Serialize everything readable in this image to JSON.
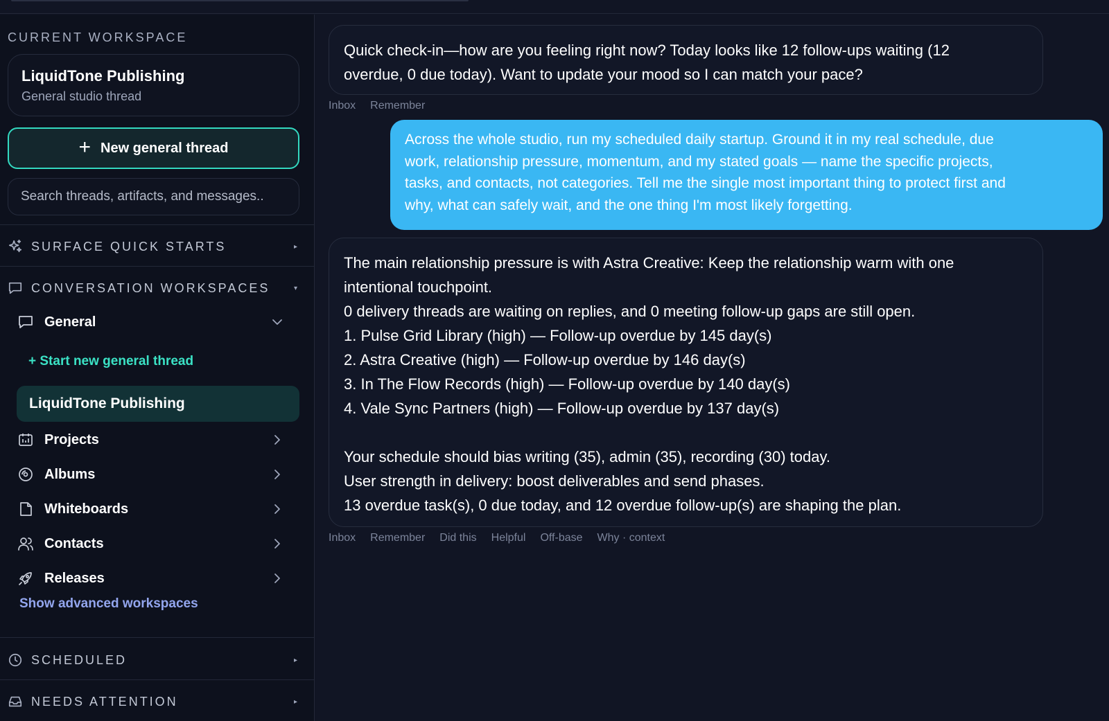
{
  "sidebar": {
    "current_workspace_label": "CURRENT WORKSPACE",
    "workspace": {
      "title": "LiquidTone Publishing",
      "subtitle": "General studio thread"
    },
    "new_thread_button": "New general thread",
    "search_placeholder": "Search threads, artifacts, and messages..",
    "groups": {
      "surface_quick_starts": "SURFACE QUICK STARTS",
      "conversation_workspaces": "CONVERSATION WORKSPACES",
      "scheduled": "SCHEDULED",
      "needs_attention": "NEEDS ATTENTION"
    },
    "nav": {
      "general": "General",
      "start_new_general_thread": "+ Start new general thread",
      "active_thread": "LiquidTone Publishing",
      "projects": "Projects",
      "albums": "Albums",
      "whiteboards": "Whiteboards",
      "contacts": "Contacts",
      "releases": "Releases",
      "show_advanced": "Show advanced workspaces"
    }
  },
  "chat": {
    "assistant_1": [
      "Quick check-in—how are you feeling right now? Today looks like 12 follow-ups waiting (12",
      "overdue, 0 due today). Want to update your mood so I can match your pace?"
    ],
    "actions_1": [
      "Inbox",
      "Remember"
    ],
    "user_1": [
      "Across the whole studio, run my scheduled daily startup. Ground it in my real schedule, due",
      "work, relationship pressure, momentum, and my stated goals — name the specific projects,",
      "tasks, and contacts, not categories. Tell me the single most important thing to protect first and",
      "why, what can safely wait, and the one thing I'm most likely forgetting."
    ],
    "assistant_2": [
      "The main relationship pressure is with Astra Creative: Keep the relationship warm with one",
      "intentional touchpoint.",
      "0 delivery threads are waiting on replies, and 0 meeting follow-up gaps are still open.",
      "1. Pulse Grid Library (high) — Follow-up overdue by 145 day(s)",
      "2. Astra Creative (high) — Follow-up overdue by 146 day(s)",
      "3. In The Flow Records (high) — Follow-up overdue by 140 day(s)",
      "4. Vale Sync Partners (high) — Follow-up overdue by 137 day(s)",
      "",
      "Your schedule should bias writing (35), admin (35), recording (30) today.",
      "User strength in delivery: boost deliverables and send phases.",
      "13 overdue task(s), 0 due today, and 12 overdue follow-up(s) are shaping the plan."
    ],
    "actions_2": [
      "Inbox",
      "Remember",
      "Did this",
      "Helpful",
      "Off-base",
      "Why · context"
    ]
  },
  "colors": {
    "accent_teal": "#33d9c0",
    "user_bubble": "#3ab7f3",
    "link_blue": "#93a6ee",
    "background": "#111524"
  }
}
